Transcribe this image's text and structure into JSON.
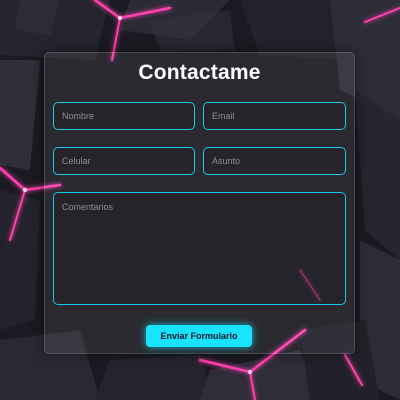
{
  "form": {
    "title": "Contactame",
    "fields": {
      "nombre": {
        "placeholder": "Nombre",
        "value": ""
      },
      "email": {
        "placeholder": "Email",
        "value": ""
      },
      "celular": {
        "placeholder": "Celular",
        "value": ""
      },
      "asunto": {
        "placeholder": "Asunto",
        "value": ""
      },
      "comentarios": {
        "placeholder": "Comentarios",
        "value": ""
      }
    },
    "submit_label": "Enviar Formulario"
  },
  "colors": {
    "accent": "#16c9e6",
    "button": "#19e4ff",
    "background": "#1b1a22",
    "neon": "#ff3fae"
  }
}
